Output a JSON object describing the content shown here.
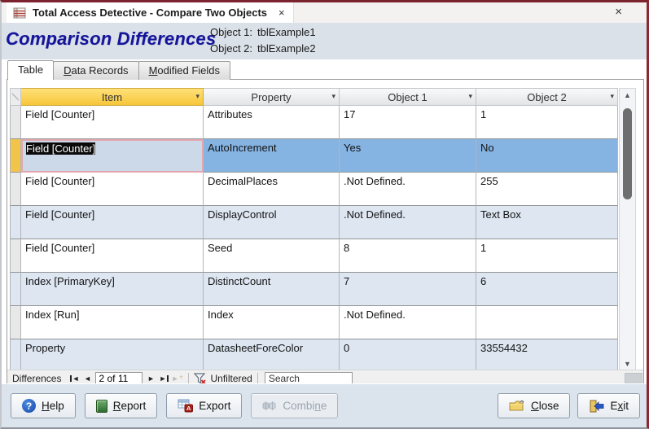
{
  "window": {
    "tab_title": "Total Access Detective - Compare Two Objects",
    "tab_close_glyph": "×",
    "window_close_glyph": "×"
  },
  "header": {
    "title": "Comparison Differences",
    "object1_label": "Object 1:",
    "object1_value": "tblExample1",
    "object2_label": "Object 2:",
    "object2_value": "tblExample2"
  },
  "tabs": [
    {
      "pre": "Table",
      "accel": "",
      "post": ""
    },
    {
      "pre": "",
      "accel": "D",
      "post": "ata Records"
    },
    {
      "pre": "",
      "accel": "M",
      "post": "odified Fields"
    }
  ],
  "grid": {
    "columns": [
      "Item",
      "Property",
      "Object 1",
      "Object 2"
    ],
    "rows": [
      {
        "item": "Field [Counter]",
        "property": "Attributes",
        "object1": "17",
        "object2": "1"
      },
      {
        "item": "Field [Counter]",
        "property": "AutoIncrement",
        "object1": "Yes",
        "object2": "No"
      },
      {
        "item": "Field [Counter]",
        "property": "DecimalPlaces",
        "object1": ".Not Defined.",
        "object2": "255"
      },
      {
        "item": "Field [Counter]",
        "property": "DisplayControl",
        "object1": ".Not Defined.",
        "object2": "Text Box"
      },
      {
        "item": "Field [Counter]",
        "property": "Seed",
        "object1": "8",
        "object2": "1"
      },
      {
        "item": "Index [PrimaryKey]",
        "property": "DistinctCount",
        "object1": "7",
        "object2": "6"
      },
      {
        "item": "Index [Run]",
        "property": "Index",
        "object1": ".Not Defined.",
        "object2": ""
      },
      {
        "item": "Property",
        "property": "DatasheetForeColor",
        "object1": "0",
        "object2": "33554432"
      }
    ]
  },
  "navbar": {
    "label": "Differences",
    "position": "2 of 11",
    "filter_label": "Unfiltered",
    "search_placeholder": "Search"
  },
  "buttons": {
    "help": {
      "pre": "",
      "accel": "H",
      "post": "elp"
    },
    "report": {
      "pre": "",
      "accel": "R",
      "post": "eport"
    },
    "export": {
      "pre": "Export",
      "accel": "",
      "post": ""
    },
    "combine": {
      "pre": "Combi",
      "accel": "n",
      "post": "e"
    },
    "close": {
      "pre": "",
      "accel": "C",
      "post": "lose"
    },
    "exit": {
      "pre": "E",
      "accel": "x",
      "post": "it"
    }
  },
  "icons": {
    "dropdown": "▾",
    "nav_prev": "◄",
    "nav_next": "►",
    "scroll_up": "▲",
    "scroll_down": "▼",
    "new_record_star": "*",
    "help_glyph": "?"
  },
  "colors": {
    "accent_border": "#7b232e",
    "title_navy": "#15159b",
    "header_gold": "#f6c63a",
    "selected_row": "#85b3e2",
    "alt_row": "#dde6f1",
    "selector_selected": "#f2c54a"
  }
}
